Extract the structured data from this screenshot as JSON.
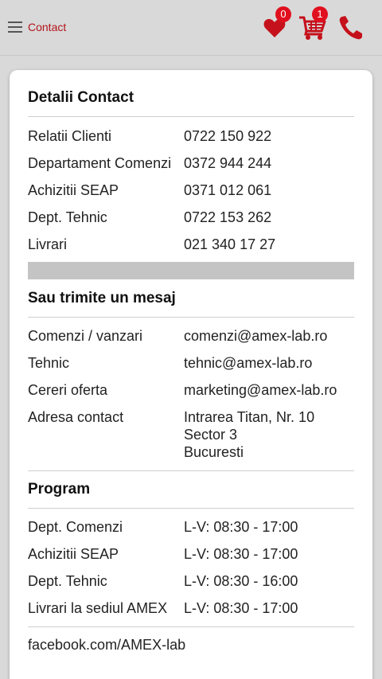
{
  "header": {
    "menu_label": "Contact",
    "wishlist_count": "0",
    "cart_count": "1"
  },
  "contact": {
    "title": "Detalii Contact",
    "rows": [
      {
        "label": "Relatii Clienti",
        "value": "0722 150 922"
      },
      {
        "label": "Departament Comenzi",
        "value": "0372 944 244"
      },
      {
        "label": "Achizitii SEAP",
        "value": "0371 012 061"
      },
      {
        "label": "Dept. Tehnic",
        "value": "0722 153 262"
      },
      {
        "label": "Livrari",
        "value": "021 340 17 27"
      }
    ]
  },
  "message": {
    "title": "Sau trimite un mesaj",
    "rows": [
      {
        "label": "Comenzi / vanzari",
        "value": "comenzi@amex-lab.ro"
      },
      {
        "label": "Tehnic",
        "value": "tehnic@amex-lab.ro"
      },
      {
        "label": "Cereri oferta",
        "value": "marketing@amex-lab.ro"
      }
    ],
    "address_label": "Adresa contact",
    "address_lines": [
      "Intrarea Titan, Nr. 10",
      "Sector 3",
      "Bucuresti"
    ]
  },
  "program": {
    "title": "Program",
    "rows": [
      {
        "label": "Dept. Comenzi",
        "value": "L-V: 08:30 - 17:00"
      },
      {
        "label": "Achizitii SEAP",
        "value": "L-V: 08:30 - 17:00"
      },
      {
        "label": "Dept. Tehnic",
        "value": "L-V: 08:30 - 16:00"
      },
      {
        "label": "Livrari la sediul AMEX",
        "value": "L-V: 08:30 - 17:00"
      }
    ]
  },
  "facebook": "facebook.com/AMEX-lab",
  "colors": {
    "accent": "#b3131a",
    "badge": "#e0101e",
    "header_bg": "#d9d9d9"
  },
  "icons": {
    "menu": "hamburger-icon",
    "wishlist": "heart-icon",
    "cart": "cart-icon",
    "phone": "phone-icon"
  }
}
